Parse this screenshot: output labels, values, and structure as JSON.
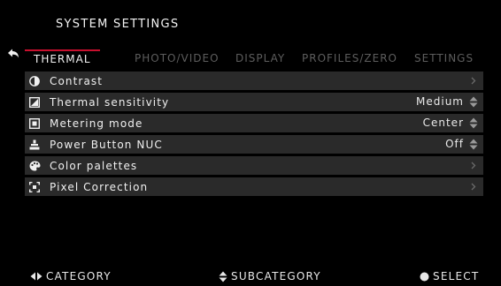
{
  "header": {
    "title": "SYSTEM SETTINGS"
  },
  "tabs": [
    {
      "label": "THERMAL",
      "active": true
    },
    {
      "label": "PHOTO/VIDEO",
      "active": false
    },
    {
      "label": "DISPLAY",
      "active": false
    },
    {
      "label": "PROFILES/ZERO",
      "active": false
    },
    {
      "label": "SETTINGS",
      "active": false
    }
  ],
  "rows": [
    {
      "label": "Contrast",
      "icon": "contrast-icon",
      "value": "",
      "control": "chevron-right-icon"
    },
    {
      "label": "Thermal sensitivity",
      "icon": "sensitivity-icon",
      "value": "Medium",
      "control": "up-down-arrows-icon"
    },
    {
      "label": "Metering mode",
      "icon": "metering-icon",
      "value": "Center",
      "control": "up-down-arrows-icon"
    },
    {
      "label": "Power Button NUC",
      "icon": "nuc-icon",
      "value": "Off",
      "control": "up-down-arrows-icon"
    },
    {
      "label": "Color palettes",
      "icon": "palette-icon",
      "value": "",
      "control": "chevron-right-icon"
    },
    {
      "label": "Pixel Correction",
      "icon": "pixel-correction-icon",
      "value": "",
      "control": "chevron-right-icon"
    }
  ],
  "footer": {
    "category": "CATEGORY",
    "subcategory": "SUBCATEGORY",
    "select": "SELECT"
  },
  "colors": {
    "accent": "#c8102e",
    "row_bg": "#2a2a2a",
    "inactive_tab": "#5d5d5d"
  }
}
